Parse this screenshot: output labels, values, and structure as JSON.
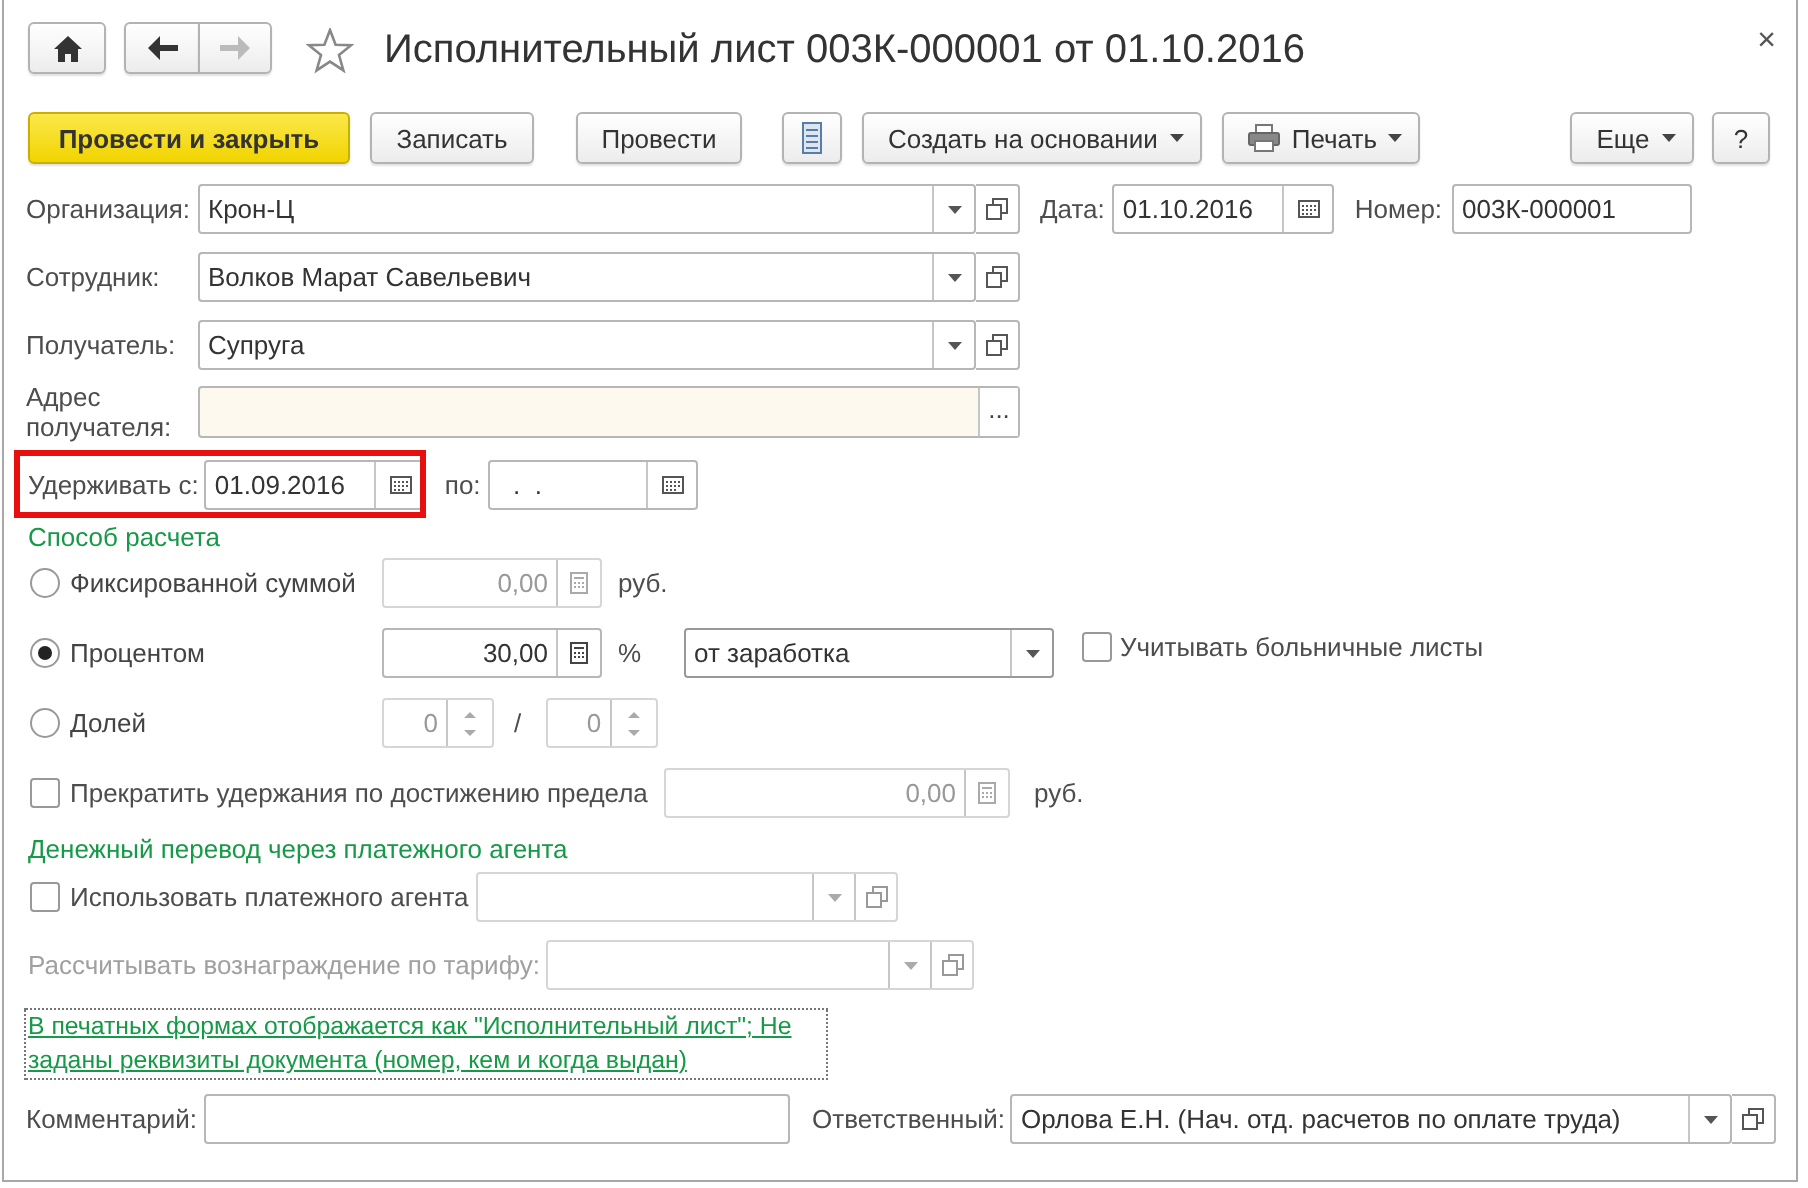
{
  "window": {
    "title": "Исполнительный лист 003К-000001 от 01.10.2016",
    "close": "×"
  },
  "toolbar": {
    "buttons": [
      {
        "kind": "primary",
        "label": "Провести и закрыть"
      },
      {
        "kind": "plain",
        "label": "Записать"
      },
      {
        "kind": "plain",
        "label": "Провести"
      },
      {
        "kind": "list"
      },
      {
        "kind": "menu",
        "label": "Создать на основании"
      },
      {
        "kind": "print",
        "label": "Печать"
      }
    ],
    "right": [
      {
        "kind": "menu",
        "label": "Еще"
      },
      {
        "kind": "plain",
        "label": "?"
      }
    ]
  },
  "organization": {
    "label": "Организация:",
    "value": "Крон-Ц"
  },
  "date": {
    "label": "Дата:",
    "value": "01.10.2016"
  },
  "number": {
    "label": "Номер:",
    "value": "003К-000001"
  },
  "employee": {
    "label": "Сотрудник:",
    "value": "Волков Марат Савельевич"
  },
  "recipient": {
    "label": "Получатель:",
    "value": "Супруга"
  },
  "address": {
    "label": "Адрес получателя:",
    "button": "..."
  },
  "withhold": {
    "label": "Удерживать с:",
    "value": "01.09.2016",
    "highlighted": true,
    "to_label": "по:",
    "to_value": "  .  ."
  },
  "calc_method": {
    "title": "Способ расчета",
    "options": [
      {
        "kind": "amount",
        "label": "Фиксированной суммой",
        "selected": false,
        "value": "0,00",
        "unit": "руб."
      },
      {
        "kind": "percent",
        "label": "Процентом",
        "selected": true,
        "value": "30,00",
        "unit": "%",
        "base": "от заработка",
        "sick_leave": {
          "label": "Учитывать больничные листы",
          "checked": false
        }
      },
      {
        "kind": "shares",
        "label": "Долей",
        "selected": false,
        "numerator": "0",
        "separator": "/",
        "denominator": "0"
      }
    ]
  },
  "limit": {
    "label": "Прекратить удержания по достижению предела",
    "checked": false,
    "value": "0,00",
    "unit": "руб."
  },
  "agent": {
    "title": "Денежный перевод через платежного агента",
    "use": {
      "label": "Использовать платежного агента",
      "checked": false
    },
    "tariff": {
      "label": "Рассчитывать вознаграждение по тарифу:",
      "disabled": true
    }
  },
  "notice": "В печатных формах отображается как \"Исполнительный лист\"; Не заданы реквизиты документа (номер, кем и когда выдан)",
  "comment": {
    "label": "Комментарий:"
  },
  "responsible": {
    "label": "Ответственный:",
    "value": "Орлова Е.Н. (Нач. отд. расчетов по оплате труда)"
  }
}
